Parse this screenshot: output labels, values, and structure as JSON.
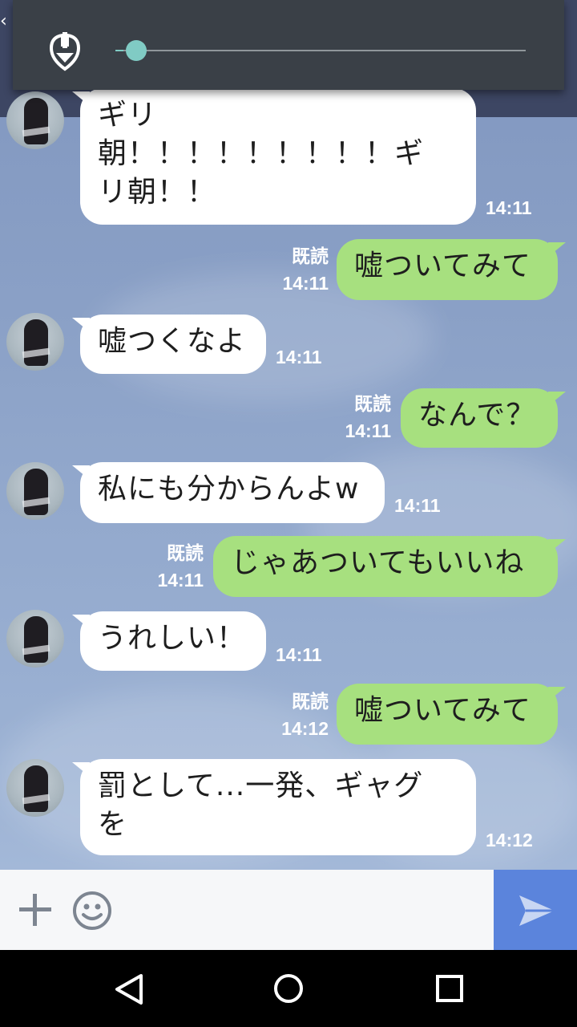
{
  "overlay": {
    "volume_icon": "alarm-volume-icon",
    "volume_level": 0.02,
    "accent": "#80cbc4"
  },
  "messages": [
    {
      "dir": "in",
      "lines": [
        "ギリ",
        "朝！！！！！！！！！ギ",
        "リ朝！！"
      ],
      "time": "14:11"
    },
    {
      "dir": "out",
      "lines": [
        "嘘ついてみて"
      ],
      "read": "既読",
      "time": "14:11"
    },
    {
      "dir": "in",
      "lines": [
        "嘘つくなよ"
      ],
      "time": "14:11"
    },
    {
      "dir": "out",
      "lines": [
        "なんで？"
      ],
      "read": "既読",
      "time": "14:11"
    },
    {
      "dir": "in",
      "lines": [
        "私にも分からんよw"
      ],
      "time": "14:11"
    },
    {
      "dir": "out",
      "lines": [
        "じゃあついてもいいね"
      ],
      "read": "既読",
      "time": "14:11"
    },
    {
      "dir": "in",
      "lines": [
        "うれしい！"
      ],
      "time": "14:11"
    },
    {
      "dir": "out",
      "lines": [
        "嘘ついてみて"
      ],
      "read": "既読",
      "time": "14:12"
    },
    {
      "dir": "in",
      "lines": [
        "罰として...一発、ギャグ",
        "を"
      ],
      "time": "14:12"
    }
  ],
  "input": {
    "plus_icon": "plus-icon",
    "emoji_icon": "smiley-icon",
    "send_icon": "send-icon"
  },
  "nav": {
    "back_icon": "back-triangle-icon",
    "home_icon": "home-circle-icon",
    "recent_icon": "recent-apps-icon"
  },
  "colors": {
    "incoming_bubble": "#ffffff",
    "outgoing_bubble": "#a7e07f",
    "send_button": "#5b84dc"
  }
}
